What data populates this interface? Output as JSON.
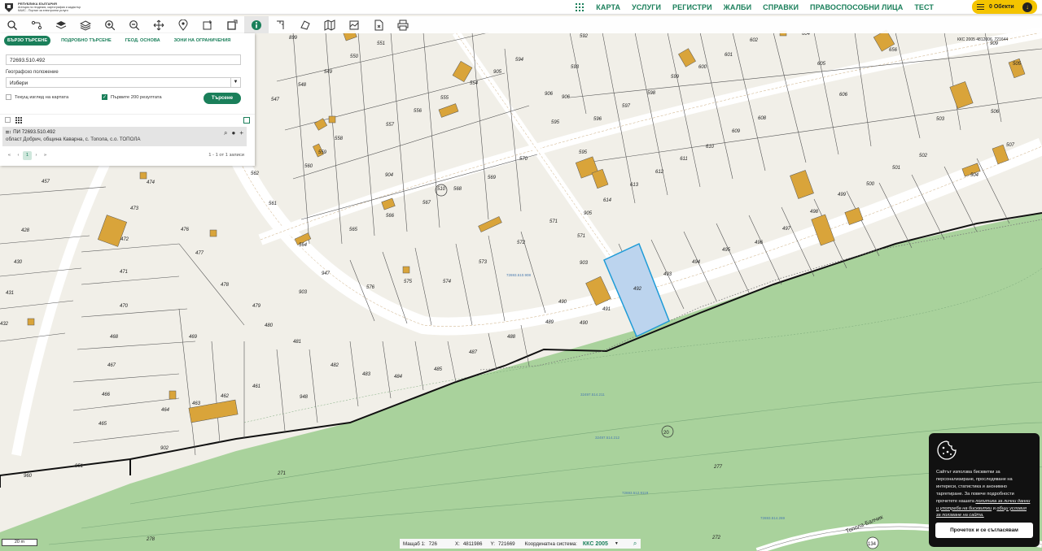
{
  "header": {
    "logo_lines": [
      "РЕПУБЛИКА БЪЛГАРИЯ",
      "Агенция по геодезия, картография и кадастър",
      "КАИС - Портал за електронни услуги"
    ],
    "nav": [
      "КАРТА",
      "УСЛУГИ",
      "РЕГИСТРИ",
      "ЖАЛБИ",
      "СПРАВКИ",
      "ПРАВОСПОСОБНИ ЛИЦА",
      "ТЕСТ"
    ],
    "objects_label": "0 Обекти"
  },
  "toolbar": {
    "tools": [
      "search-icon",
      "route-icon",
      "layers-icon",
      "layers-alt-icon",
      "zoom-in-icon",
      "zoom-out-icon",
      "pan-icon",
      "location-pin-icon",
      "select-rect-icon",
      "select-rect-alt-icon",
      "info-icon",
      "measure-line-icon",
      "measure-area-icon",
      "map-icon",
      "profile-icon",
      "export-icon",
      "print-icon"
    ],
    "active_tool": "info-icon"
  },
  "search": {
    "tabs": [
      "БЪРЗО ТЪРСЕНЕ",
      "ПОДРОБНО ТЪРСЕНЕ",
      "ГЕОД. ОСНОВА",
      "ЗОНИ НА ОГРАНИЧЕНИЯ"
    ],
    "query_value": "72693.510.492",
    "geo_label": "Географско положение",
    "geo_value": "Избери",
    "chk_current_view": "Текущ изглед на картата",
    "chk_first_200": "Първите 200 резултата",
    "search_button": "Търсене"
  },
  "results": {
    "title": "ПИ 72693.510.492",
    "subtitle": "област Добрич, община Каварна, с. Топола, с.о. ТОПОЛА",
    "pager": [
      "«",
      "‹",
      "1",
      "›",
      "»"
    ],
    "summary": "1 - 1 от 1 записи"
  },
  "map": {
    "parcel_labels": [
      [
        "899",
        360,
        48
      ],
      [
        "550",
        435,
        71
      ],
      [
        "551",
        468,
        55
      ],
      [
        "592",
        717,
        46
      ],
      [
        "602",
        926,
        51
      ],
      [
        "604",
        990,
        43
      ],
      [
        "656",
        1097,
        63
      ],
      [
        "909",
        1221,
        55
      ],
      [
        "549",
        403,
        90
      ],
      [
        "554",
        582,
        104
      ],
      [
        "905",
        611,
        90
      ],
      [
        "594",
        638,
        75
      ],
      [
        "593",
        706,
        84
      ],
      [
        "600",
        863,
        84
      ],
      [
        "601",
        895,
        69
      ],
      [
        "605",
        1009,
        80
      ],
      [
        "505",
        1249,
        80
      ],
      [
        "548",
        371,
        106
      ],
      [
        "906",
        674,
        117
      ],
      [
        "906",
        695,
        121
      ],
      [
        "599",
        829,
        96
      ],
      [
        "598",
        800,
        116
      ],
      [
        "597",
        769,
        132
      ],
      [
        "606",
        1036,
        118
      ],
      [
        "506",
        1222,
        139
      ],
      [
        "547",
        338,
        124
      ],
      [
        "555",
        546,
        122
      ],
      [
        "556",
        513,
        138
      ],
      [
        "557",
        479,
        155
      ],
      [
        "595",
        682,
        152
      ],
      [
        "596",
        734,
        148
      ],
      [
        "503",
        1155,
        148
      ],
      [
        "558",
        416,
        172
      ],
      [
        "609",
        904,
        163
      ],
      [
        "608",
        936,
        147
      ],
      [
        "610",
        872,
        182
      ],
      [
        "507",
        1241,
        180
      ],
      [
        "560",
        379,
        206
      ],
      [
        "570",
        643,
        197
      ],
      [
        "595",
        716,
        189
      ],
      [
        "611",
        840,
        197
      ],
      [
        "612",
        810,
        213
      ],
      [
        "502",
        1134,
        193
      ],
      [
        "504",
        1197,
        217
      ],
      [
        "562",
        313,
        215
      ],
      [
        "559",
        396,
        189
      ],
      [
        "904",
        478,
        217
      ],
      [
        "569",
        604,
        220
      ],
      [
        "510",
        542,
        234
      ],
      [
        "568",
        562,
        234
      ],
      [
        "613",
        779,
        229
      ],
      [
        "614",
        746,
        248
      ],
      [
        "501",
        1101,
        208
      ],
      [
        "457",
        56,
        225
      ],
      [
        "474",
        185,
        226
      ],
      [
        "567",
        524,
        251
      ],
      [
        "561",
        335,
        252
      ],
      [
        "499",
        1034,
        241
      ],
      [
        "500",
        1069,
        228
      ],
      [
        "473",
        165,
        258
      ],
      [
        "566",
        479,
        267
      ],
      [
        "565",
        434,
        284
      ],
      [
        "571",
        680,
        274
      ],
      [
        "905",
        722,
        264
      ],
      [
        "498",
        1000,
        262
      ],
      [
        "497",
        966,
        283
      ],
      [
        "428",
        31,
        285
      ],
      [
        "472",
        153,
        296
      ],
      [
        "476",
        227,
        284
      ],
      [
        "564",
        372,
        303
      ],
      [
        "571",
        714,
        292
      ],
      [
        "572",
        640,
        300
      ],
      [
        "496",
        932,
        300
      ],
      [
        "495",
        892,
        309
      ],
      [
        "477",
        245,
        313
      ],
      [
        "947",
        400,
        338
      ],
      [
        "573",
        593,
        324
      ],
      [
        "903",
        717,
        325
      ],
      [
        "494",
        855,
        324
      ],
      [
        "493",
        820,
        339
      ],
      [
        "430",
        22,
        324
      ],
      [
        "471",
        152,
        336
      ],
      [
        "478",
        276,
        352
      ],
      [
        "903",
        372,
        361
      ],
      [
        "576",
        455,
        355
      ],
      [
        "575",
        501,
        348
      ],
      [
        "574",
        549,
        348
      ],
      [
        "492",
        783,
        357
      ],
      [
        "491",
        745,
        382
      ],
      [
        "431",
        12,
        362
      ],
      [
        "470",
        152,
        378
      ],
      [
        "490",
        691,
        373
      ],
      [
        "490",
        717,
        399
      ],
      [
        "489",
        675,
        398
      ],
      [
        "432",
        5,
        400
      ],
      [
        "479",
        315,
        378
      ],
      [
        "480",
        330,
        402
      ],
      [
        "469",
        237,
        416
      ],
      [
        "488",
        628,
        416
      ],
      [
        "468",
        140,
        416
      ],
      [
        "481",
        365,
        422
      ],
      [
        "487",
        581,
        435
      ],
      [
        "485",
        538,
        456
      ],
      [
        "484",
        489,
        465
      ],
      [
        "483",
        450,
        462
      ],
      [
        "482",
        411,
        451
      ],
      [
        "467",
        137,
        451
      ],
      [
        "461",
        315,
        477
      ],
      [
        "948",
        373,
        490
      ],
      [
        "466",
        130,
        487
      ],
      [
        "463",
        241,
        498
      ],
      [
        "462",
        276,
        489
      ],
      [
        "464",
        203,
        506
      ],
      [
        "465",
        126,
        523
      ],
      [
        "902",
        202,
        553
      ],
      [
        "951",
        97,
        575
      ],
      [
        "271",
        346,
        584
      ],
      [
        "277",
        882,
        576
      ],
      [
        "960",
        34,
        587
      ],
      [
        "278",
        185,
        665
      ],
      [
        "272",
        880,
        663
      ]
    ],
    "road_labels": [
      "Топола-Балчик",
      "134",
      "20"
    ],
    "sheet_labels": [
      "72693.510.908",
      "32497.514.211",
      "32497.514.212",
      "72693.512.9119",
      "72693.514.269",
      "72693.514.268"
    ],
    "coord_tag": "ККС 2005 4812006, 721644"
  },
  "statusbar": {
    "scale_bar": "20 m",
    "scale_label": "Мащаб 1:",
    "scale_value": "726",
    "x_label": "X:",
    "x_value": "4811986",
    "y_label": "Y:",
    "y_value": "721669",
    "system_label": "Координатна система:",
    "system_value": "ККС 2005"
  },
  "cookie": {
    "text_before": "Сайтът използва бисквитки за персонализиране, проследяване на интереси, статистика и анонимно таргетиране. За повече подробности прочетете нашата ",
    "link1": "политика за лични данни и употреба на бисквитки",
    "text_mid": " и ",
    "link2": "общи условия за ползване на сайта.",
    "button": "Прочетох и се съгласявам"
  },
  "colors": {
    "brand": "#1a7f5a",
    "accent": "#f4c400",
    "parcel_fill": "#f1efe8",
    "forest": "#a9d29c",
    "building": "#d9a43a",
    "selected": "#bcd4ee"
  }
}
